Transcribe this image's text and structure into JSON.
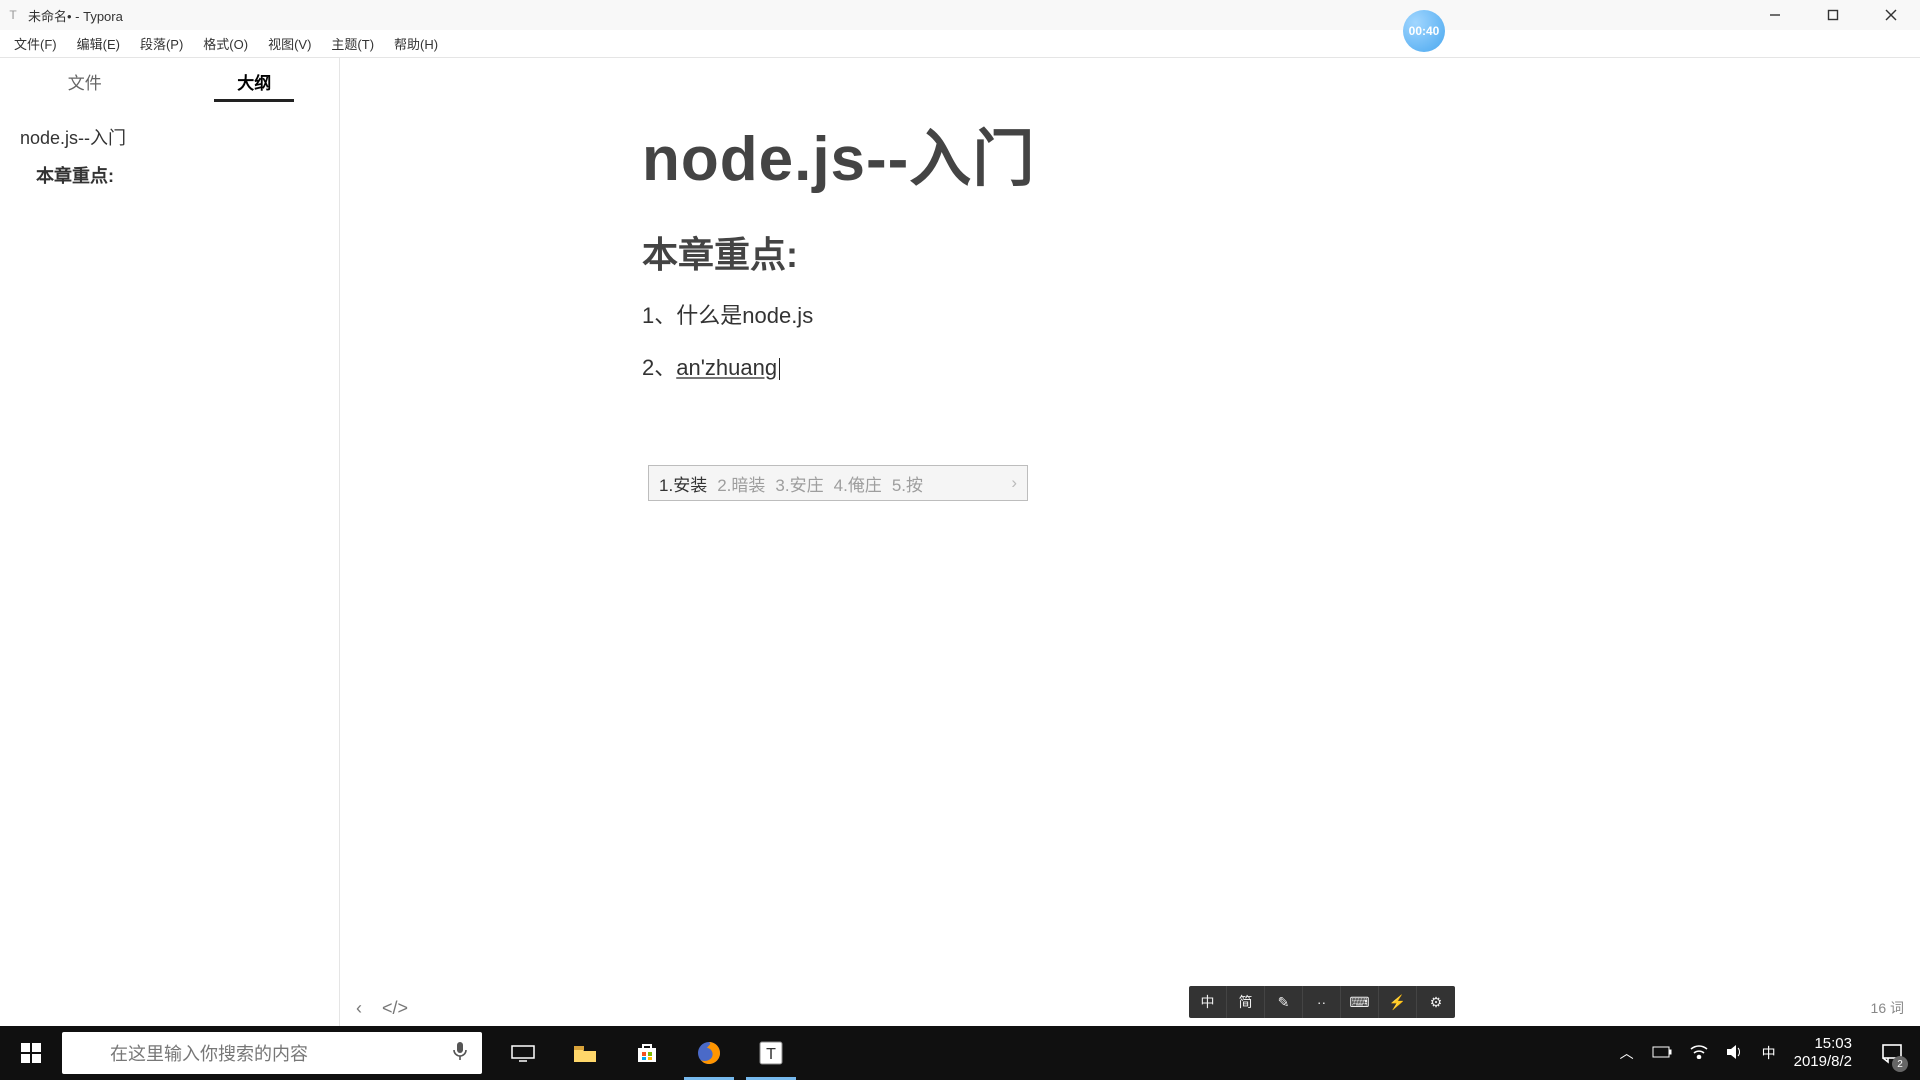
{
  "window": {
    "title": "未命名• - Typora"
  },
  "menus": [
    "文件(F)",
    "编辑(E)",
    "段落(P)",
    "格式(O)",
    "视图(V)",
    "主题(T)",
    "帮助(H)"
  ],
  "sidebar": {
    "tabs": [
      "文件",
      "大纲"
    ],
    "active_tab": 1,
    "outline": [
      {
        "level": 1,
        "text": "node.js--入门"
      },
      {
        "level": 2,
        "text": "本章重点:"
      }
    ]
  },
  "document": {
    "h1": "node.js--入门",
    "h2": "本章重点:",
    "lines": [
      {
        "prefix": "1、",
        "text": "什么是node.js"
      },
      {
        "prefix": "2、",
        "text": "an'zhuang",
        "underline": true,
        "ime_active": true
      }
    ]
  },
  "ime": {
    "candidates": [
      {
        "n": "1",
        "w": "安装",
        "selected": true
      },
      {
        "n": "2",
        "w": "暗装"
      },
      {
        "n": "3",
        "w": "安庄"
      },
      {
        "n": "4",
        "w": "俺庄"
      },
      {
        "n": "5",
        "w": "按"
      }
    ],
    "more": "›"
  },
  "ime_toolbar": [
    "中",
    "简",
    "✎",
    "··",
    "⌨",
    "⚡",
    "⚙"
  ],
  "status": {
    "back": "‹",
    "source": "</>",
    "word_count": "16 词"
  },
  "badge": "00:40",
  "taskbar": {
    "search_placeholder": "在这里输入你搜索的内容",
    "tray": {
      "ime": "中",
      "time": "15:03",
      "date": "2019/8/2",
      "notif_count": "2"
    }
  }
}
